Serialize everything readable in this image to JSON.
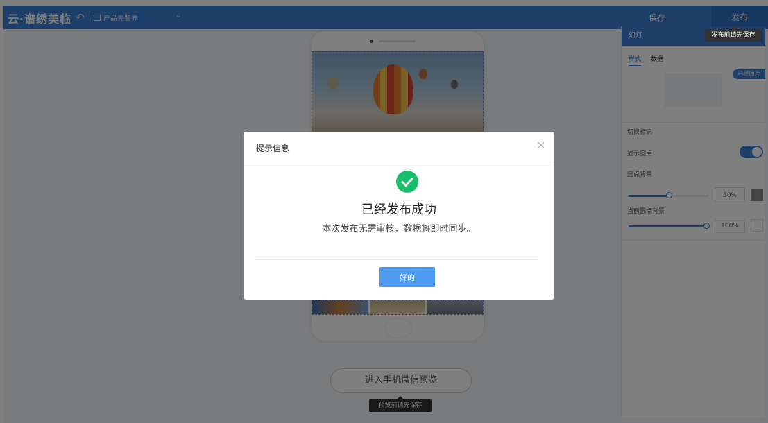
{
  "header": {
    "logo": "云·谱绣美临",
    "undo_icon": "undo-icon",
    "product_selector": "产品先鉴界",
    "save_label": "保存",
    "publish_label": "发布",
    "publish_tooltip": "发布前请先保存"
  },
  "panel": {
    "title": "幻灯",
    "tabs": [
      "样式",
      "数据"
    ],
    "fill_label": "已经图片",
    "switch_indicator_label": "切换标识",
    "show_dot_label": "显示圆点",
    "show_dot_enabled": true,
    "dot_bg_label": "圆点背景",
    "dot_bg_percent": "50%",
    "dot_bg_level": 0.5,
    "active_dot_bg_label": "当前圆点背景",
    "active_dot_bg_percent": "100%",
    "active_dot_bg_level": 1.0,
    "colors": {
      "accent": "#3a7fd5",
      "dot_swatch": "#8a8a8a",
      "active_swatch": "#ffffff"
    }
  },
  "canvas": {
    "preview_button": "进入手机微信预览",
    "preview_tooltip": "预览前请先保存"
  },
  "dialog": {
    "title": "提示信息",
    "close_icon": "close-icon",
    "success_icon": "check-circle-icon",
    "message_title": "已经发布成功",
    "message_sub": "本次发布无需审核，数据将即时同步。",
    "ok_label": "好的",
    "colors": {
      "success": "#19be6b",
      "primary": "#4e9cf1"
    }
  }
}
